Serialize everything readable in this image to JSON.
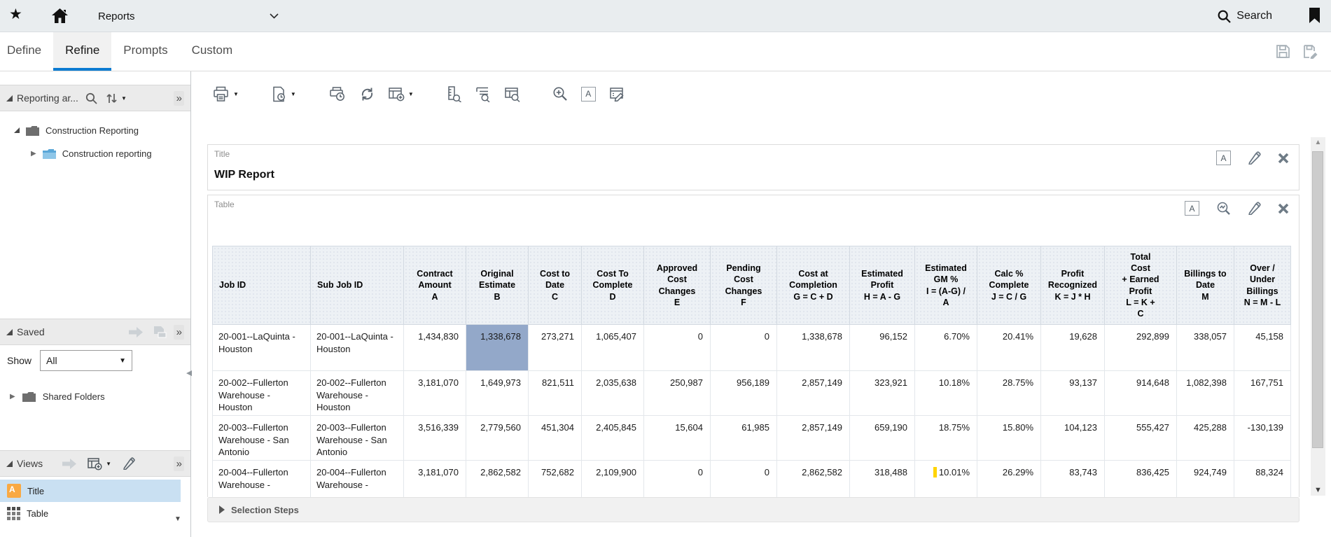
{
  "topbar": {
    "nav_menu_label": "Reports",
    "search_label": "Search"
  },
  "tabbar": {
    "tabs": [
      {
        "label": "Define"
      },
      {
        "label": "Refine"
      },
      {
        "label": "Prompts"
      },
      {
        "label": "Custom"
      }
    ],
    "active_tab": "Refine"
  },
  "sidebar": {
    "reporting_panel": {
      "title": "Reporting ar...",
      "tree": [
        {
          "label": "Construction Reporting"
        },
        {
          "label": "Construction reporting"
        }
      ]
    },
    "saved_panel": {
      "title": "Saved",
      "show_label": "Show",
      "show_value": "All",
      "tree": [
        {
          "label": "Shared Folders"
        }
      ]
    },
    "views_panel": {
      "title": "Views",
      "items": [
        {
          "label": "Title"
        },
        {
          "label": "Table"
        }
      ]
    }
  },
  "report": {
    "title_section": {
      "label": "Title",
      "heading": "WIP Report"
    },
    "table_section": {
      "label": "Table"
    },
    "selection_steps_label": "Selection Steps"
  },
  "table": {
    "columns": [
      "Job ID",
      "Sub Job ID",
      "Contract\nAmount\nA",
      "Original\nEstimate\nB",
      "Cost to\nDate\nC",
      "Cost To\nComplete\nD",
      "Approved\nCost\nChanges\nE",
      "Pending\nCost\nChanges\nF",
      "Cost at\nCompletion\nG = C + D",
      "Estimated\nProfit\nH = A - G",
      "Estimated\nGM %\nI = (A-G) /\nA",
      "Calc %\nComplete\nJ = C / G",
      "Profit\nRecognized\nK = J * H",
      "Total\nCost\n+ Earned\nProfit\nL = K +\nC",
      "Billings to\nDate\nM",
      "Over /\nUnder\nBillings\nN = M - L"
    ],
    "rows": [
      {
        "highlight_col": 3,
        "cells": [
          "20-001--LaQuinta - Houston",
          "20-001--LaQuinta - Houston",
          "1,434,830",
          "1,338,678",
          "273,271",
          "1,065,407",
          "0",
          "0",
          "1,338,678",
          "96,152",
          "6.70%",
          "20.41%",
          "19,628",
          "292,899",
          "338,057",
          "45,158"
        ]
      },
      {
        "cells": [
          "20-002--Fullerton Warehouse - Houston",
          "20-002--Fullerton Warehouse - Houston",
          "3,181,070",
          "1,649,973",
          "821,511",
          "2,035,638",
          "250,987",
          "956,189",
          "2,857,149",
          "323,921",
          "10.18%",
          "28.75%",
          "93,137",
          "914,648",
          "1,082,398",
          "167,751"
        ]
      },
      {
        "cells": [
          "20-003--Fullerton Warehouse - San Antonio",
          "20-003--Fullerton Warehouse - San Antonio",
          "3,516,339",
          "2,779,560",
          "451,304",
          "2,405,845",
          "15,604",
          "61,985",
          "2,857,149",
          "659,190",
          "18.75%",
          "15.80%",
          "104,123",
          "555,427",
          "425,288",
          "-130,139"
        ]
      },
      {
        "marker_col": 10,
        "cells": [
          "20-004--Fullerton Warehouse -",
          "20-004--Fullerton Warehouse -",
          "3,181,070",
          "2,862,582",
          "752,682",
          "2,109,900",
          "0",
          "0",
          "2,862,582",
          "318,488",
          "10.01%",
          "26.29%",
          "83,743",
          "836,425",
          "924,749",
          "88,324"
        ]
      }
    ]
  },
  "icons": {
    "star": "★",
    "caret_down": "▼",
    "double_chevron_right": "»",
    "triangle_collapsed": "▶",
    "scroll_up": "▲",
    "scroll_down": "▼",
    "splitter_left": "◀",
    "letter_a": "A"
  },
  "colors": {
    "accent_blue": "#0c7bd1",
    "highlight_cell": "#93a8c9",
    "marker_yellow": "#ffd400",
    "selected_view_bg": "#c9e0f2",
    "view_title_icon_orange": "#f9a943"
  }
}
